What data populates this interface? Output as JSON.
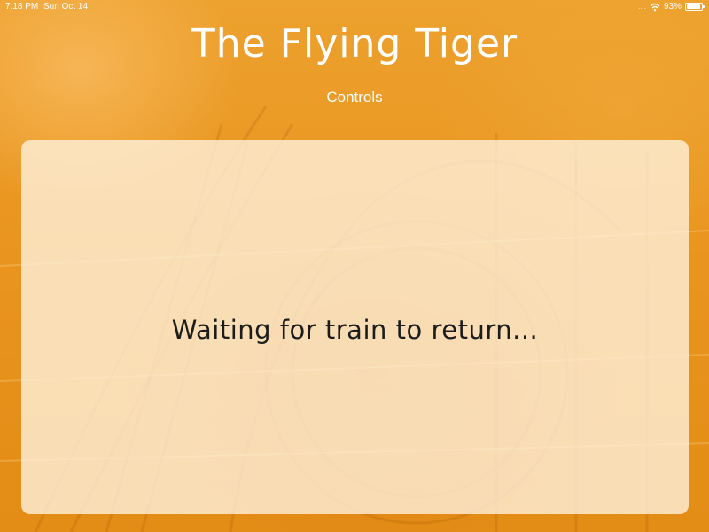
{
  "status_bar": {
    "time": "7:18 PM",
    "date": "Sun Oct 14",
    "signal": "....",
    "battery_percent": "93%",
    "battery_level": 0.93,
    "icons": [
      "wifi-icon",
      "battery-icon"
    ]
  },
  "header": {
    "title": "The Flying Tiger",
    "subtitle": "Controls"
  },
  "panel": {
    "message": "Waiting for train to return..."
  },
  "colors": {
    "background": "#e8941c",
    "panel": "#fff3e0",
    "text_dark": "#1c1c1c",
    "text_light": "#ffffff"
  }
}
